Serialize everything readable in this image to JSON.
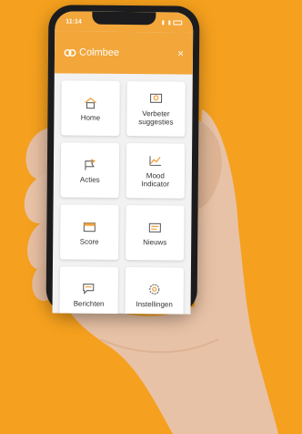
{
  "colors": {
    "background": "#f5a01e",
    "accent": "#f3a63a",
    "icon": "#f0a03a",
    "skin": "#e8c2a6"
  },
  "status": {
    "time": "11:14"
  },
  "header": {
    "brand": "Colmbee",
    "close": "×"
  },
  "menu": [
    {
      "label": "Home",
      "icon": "home-icon"
    },
    {
      "label": "Verbeter\nsuggesties",
      "icon": "lightbulb-icon"
    },
    {
      "label": "Acties",
      "icon": "flag-icon"
    },
    {
      "label": "Mood\nIndicator",
      "icon": "trend-chart-icon"
    },
    {
      "label": "Score",
      "icon": "calendar-icon"
    },
    {
      "label": "Nieuws",
      "icon": "newspaper-icon"
    },
    {
      "label": "Berichten",
      "icon": "chat-icon"
    },
    {
      "label": "Instellingen",
      "icon": "gear-icon"
    }
  ]
}
